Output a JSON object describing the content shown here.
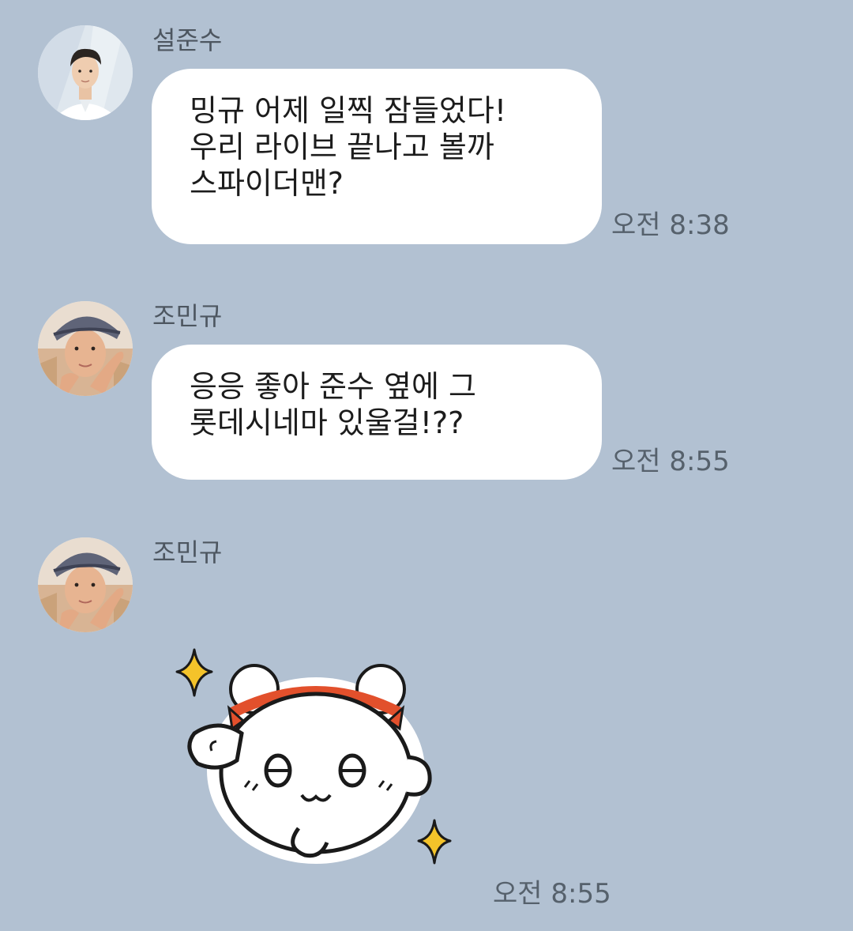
{
  "messages": [
    {
      "sender": "설준수",
      "text": "밍규 어제 일찍 잠들었다!\n우리 라이브 끝나고 볼까\n스파이더맨?",
      "time": "오전 8:38"
    },
    {
      "sender": "조민규",
      "text": "응응 좋아 준수 옆에 그\n롯데시네마 있울걸!??",
      "time": "오전 8:55"
    },
    {
      "sender": "조민규",
      "sticker": "white-bear-salute-sticker",
      "time": "오전 8:55"
    }
  ],
  "colors": {
    "background": "#b2c1d2",
    "bubble": "#ffffff",
    "sparkle": "#f4c32a",
    "ribbon": "#e2502c"
  }
}
